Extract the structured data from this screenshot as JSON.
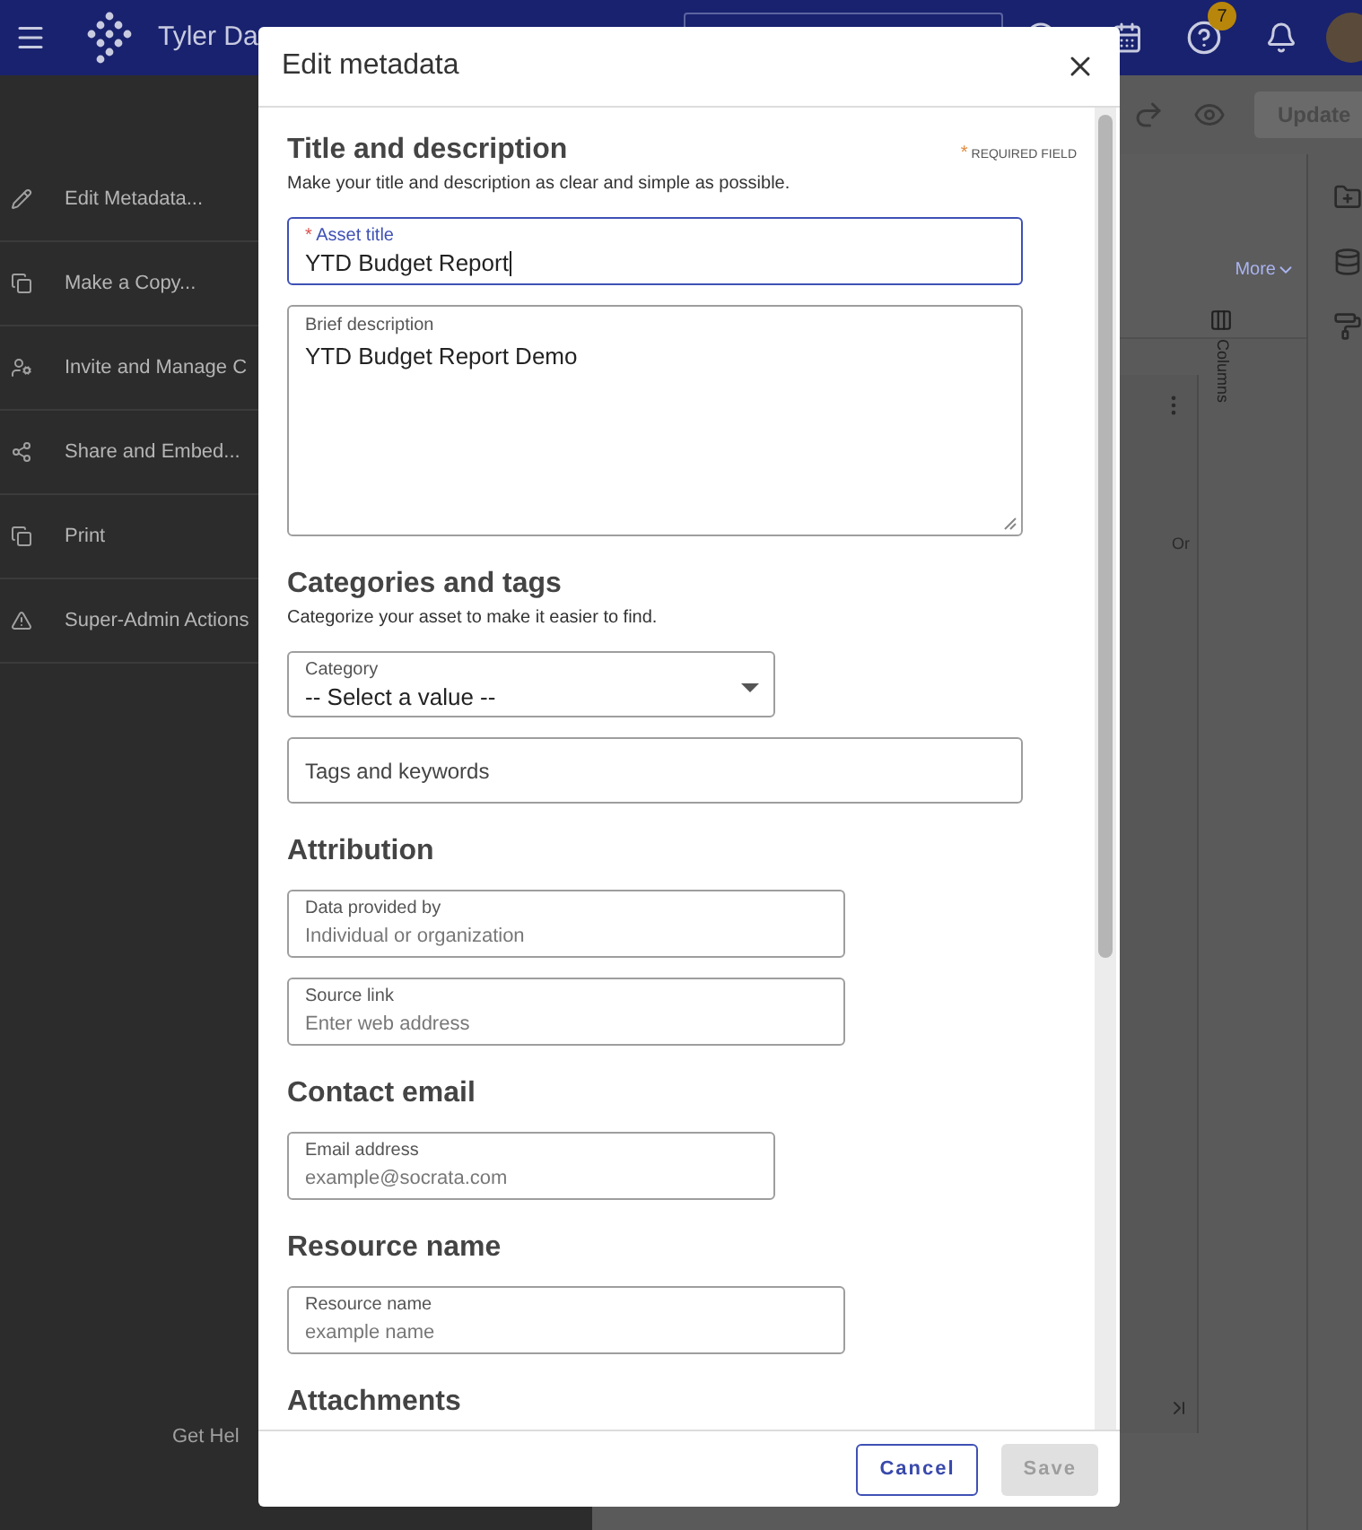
{
  "top_bar": {
    "title": "Tyler Da",
    "notification_count": "7"
  },
  "sidebar": {
    "items": [
      {
        "label": "Edit Metadata..."
      },
      {
        "label": "Make a Copy..."
      },
      {
        "label": "Invite and Manage C"
      },
      {
        "label": "Share and Embed..."
      },
      {
        "label": "Print"
      },
      {
        "label": "Super-Admin Actions"
      }
    ],
    "footer_link": "Get Hel"
  },
  "toolbar": {
    "button": "Update"
  },
  "workspace": {
    "link": "More",
    "column_header": "Or",
    "columns_tab": "Columns"
  },
  "dialog": {
    "title": "Edit metadata",
    "required_mark": "*",
    "required_note": "REQUIRED FIELD",
    "sections": [
      {
        "heading": "Title and description",
        "subtitle": "Make your title and description as clear and simple as possible.",
        "fields": [
          {
            "kind": "text",
            "label": "Asset title",
            "value": "YTD Budget Report",
            "required": true,
            "focused": true
          },
          {
            "kind": "textarea",
            "label": "Brief description",
            "value": "YTD Budget Report Demo",
            "required": false,
            "focused": false
          }
        ]
      },
      {
        "heading": "Categories and tags",
        "subtitle": "Categorize your asset to make it easier to find.",
        "fields": [
          {
            "kind": "select",
            "label": "Category",
            "value": "-- Select a value --",
            "required": false,
            "focused": false
          },
          {
            "kind": "tags",
            "placeholder": "Tags and keywords",
            "required": false,
            "focused": false
          }
        ]
      },
      {
        "heading": "Attribution",
        "fields": [
          {
            "kind": "text",
            "label": "Data provided by",
            "placeholder": "Individual or organization",
            "required": false,
            "focused": false
          },
          {
            "kind": "text",
            "label": "Source link",
            "placeholder": "Enter web address",
            "required": false,
            "focused": false
          }
        ]
      },
      {
        "heading": "Contact email",
        "fields": [
          {
            "kind": "text",
            "label": "Email address",
            "placeholder": "example@socrata.com",
            "required": false,
            "focused": false
          }
        ]
      },
      {
        "heading": "Resource name",
        "fields": [
          {
            "kind": "text",
            "label": "Resource name",
            "placeholder": "example name",
            "required": false,
            "focused": false
          }
        ]
      },
      {
        "heading": "Attachments"
      }
    ],
    "buttons": [
      {
        "label": "Cancel",
        "kind": "secondary",
        "disabled": false
      },
      {
        "label": "Save",
        "kind": "primary",
        "disabled": true
      }
    ]
  }
}
